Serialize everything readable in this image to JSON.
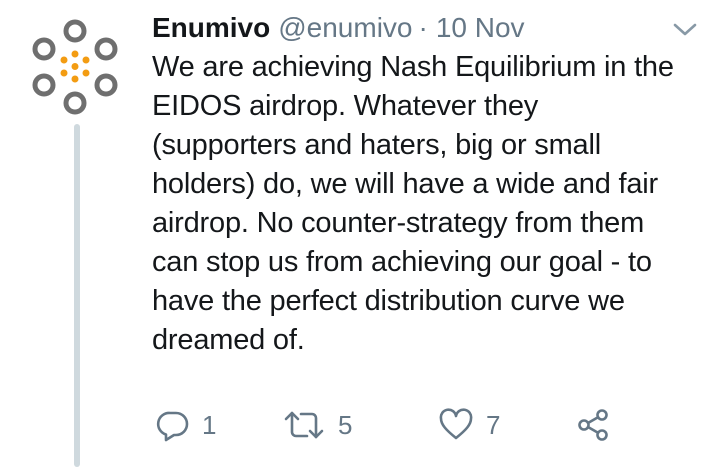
{
  "tweet": {
    "author": {
      "display_name": "Enumivo",
      "handle": "@enumivo",
      "avatar_icon": "enumivo-logo-icon"
    },
    "separator": "·",
    "timestamp": "10 Nov",
    "text": "We are achieving Nash Equilibrium in the\nEIDOS airdrop. Whatever they\n(supporters and haters, big or small\nholders) do, we will have a wide and fair\nairdrop. No counter-strategy from them\ncan stop us from achieving our goal - to\nhave the perfect distribution curve we\ndreamed of.",
    "actions": {
      "reply": {
        "icon": "reply-icon",
        "count": "1"
      },
      "retweet": {
        "icon": "retweet-icon",
        "count": "5"
      },
      "like": {
        "icon": "heart-icon",
        "count": "7"
      },
      "share": {
        "icon": "share-icon"
      }
    },
    "menu_icon": "chevron-down-icon"
  },
  "colors": {
    "text_primary": "#14171a",
    "text_secondary": "#657786",
    "thread_line": "#cfd9de",
    "logo_gray": "#6f6f6f",
    "logo_orange": "#f39c12"
  }
}
